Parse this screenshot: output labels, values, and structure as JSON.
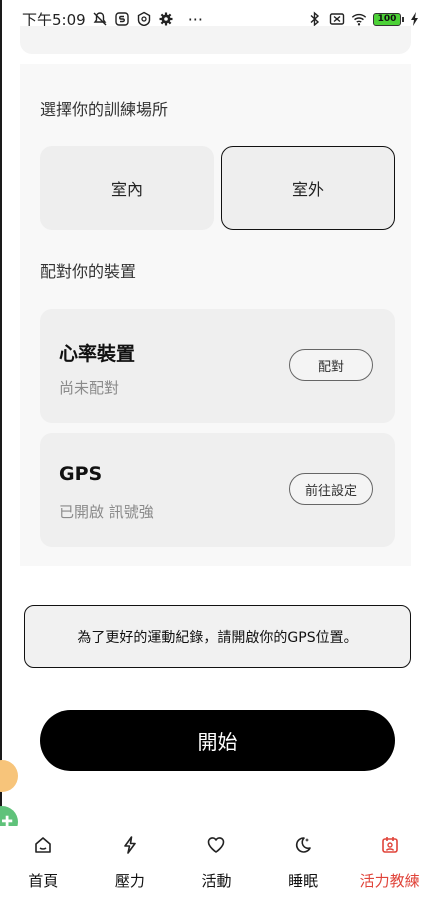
{
  "status_bar": {
    "time": "下午5:09",
    "more": "···",
    "battery_level": "100"
  },
  "location": {
    "title": "選擇你的訓練場所",
    "options": [
      {
        "label": "室內",
        "selected": false
      },
      {
        "label": "室外",
        "selected": true
      }
    ]
  },
  "devices": {
    "title": "配對你的裝置",
    "items": [
      {
        "name": "心率裝置",
        "status": "尚未配對",
        "action": "配對"
      },
      {
        "name": "GPS",
        "status": "已開啟 訊號強",
        "action": "前往設定"
      }
    ]
  },
  "notice": {
    "text": "為了更好的運動紀錄，請開啟你的GPS位置。"
  },
  "start_button": {
    "label": "開始"
  },
  "bottom_nav": {
    "items": [
      {
        "label": "首頁",
        "icon": "home-icon"
      },
      {
        "label": "壓力",
        "icon": "lightning-icon"
      },
      {
        "label": "活動",
        "icon": "heart-icon"
      },
      {
        "label": "睡眠",
        "icon": "moon-icon"
      },
      {
        "label": "活力教練",
        "icon": "coach-icon",
        "active": true
      }
    ],
    "active_color": "#e0443a"
  }
}
